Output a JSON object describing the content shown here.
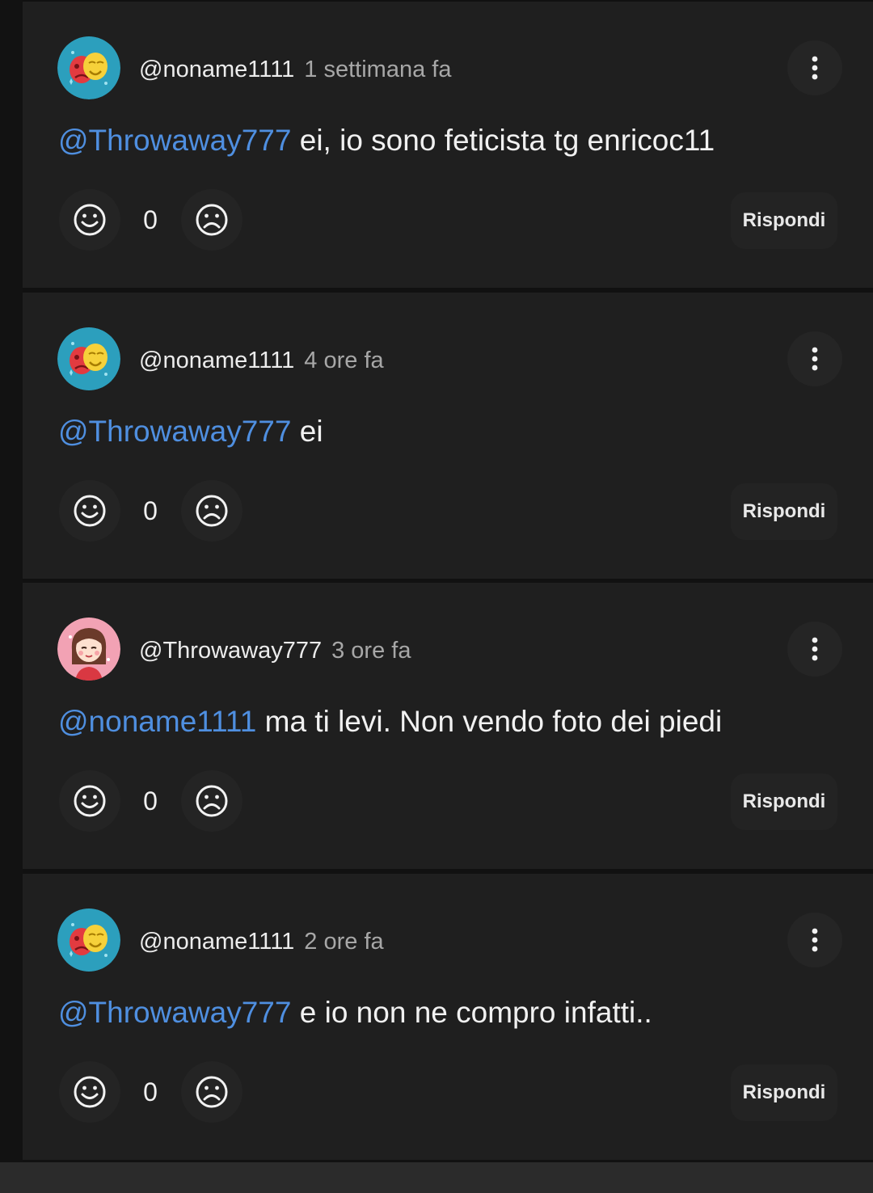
{
  "comments": [
    {
      "author": "@noname1111",
      "time": "1 settimana fa",
      "avatar": "masks-avatar",
      "mention": "@Throwaway777",
      "text": " ei, io sono feticista tg enricoc11",
      "score": "0",
      "reply_label": "Rispondi"
    },
    {
      "author": "@noname1111",
      "time": "4 ore fa",
      "avatar": "masks-avatar",
      "mention": "@Throwaway777",
      "text": " ei",
      "score": "0",
      "reply_label": "Rispondi"
    },
    {
      "author": "@Throwaway777",
      "time": "3 ore fa",
      "avatar": "girl-avatar",
      "mention": "@noname1111",
      "text": " ma ti levi. Non vendo foto dei piedi",
      "score": "0",
      "reply_label": "Rispondi"
    },
    {
      "author": "@noname1111",
      "time": "2 ore fa",
      "avatar": "masks-avatar",
      "mention": "@Throwaway777",
      "text": " e io non ne compro infatti..",
      "score": "0",
      "reply_label": "Rispondi"
    }
  ],
  "icons": {
    "upvote": "smile-face-icon",
    "downvote": "sad-face-icon",
    "menu": "more-vertical-icon"
  },
  "colors": {
    "background": "#1f1f1f",
    "mention": "#4f8fe0",
    "text": "#f1f1f1",
    "timestamp": "#a7a7a7"
  }
}
